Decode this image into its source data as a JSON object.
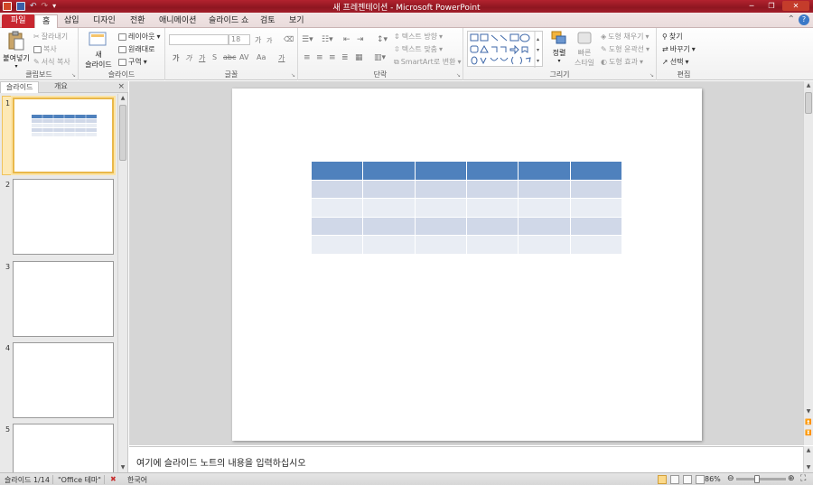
{
  "app": {
    "title": "새 프레젠테이션 - Microsoft PowerPoint"
  },
  "quick_access": {
    "save_icon": "save-icon",
    "undo_icon": "undo-icon",
    "redo_icon": "redo-icon"
  },
  "tabs": [
    {
      "label": "파일"
    },
    {
      "label": "홈"
    },
    {
      "label": "삽입"
    },
    {
      "label": "디자인"
    },
    {
      "label": "전환"
    },
    {
      "label": "애니메이션"
    },
    {
      "label": "슬라이드 쇼"
    },
    {
      "label": "검토"
    },
    {
      "label": "보기"
    }
  ],
  "active_tab": "홈",
  "ribbon": {
    "clipboard": {
      "label": "클립보드",
      "paste": "붙여넣기",
      "cut": "잘라내기",
      "copy": "복사",
      "format_painter": "서식 복사"
    },
    "slides": {
      "label": "슬라이드",
      "new_slide_line1": "새",
      "new_slide_line2": "슬라이드",
      "layout": "레이아웃",
      "reset": "원래대로",
      "section": "구역"
    },
    "font": {
      "label": "글꼴",
      "font_name": "",
      "font_size": "18",
      "grow": "가",
      "shrink": "가",
      "bold": "가",
      "italic": "가",
      "underline": "가",
      "shadow": "S",
      "strike": "abc",
      "spacing": "AV",
      "case": "Aa",
      "color": "가"
    },
    "paragraph": {
      "label": "단락",
      "text_direction": "텍스트 방향",
      "align_text": "텍스트 맞춤",
      "smartart": "SmartArt로 변환"
    },
    "drawing": {
      "label": "그리기",
      "arrange": "정렬",
      "quick_styles_line1": "빠른",
      "quick_styles_line2": "스타일",
      "shape_fill": "도형 채우기",
      "shape_outline": "도형 윤곽선",
      "shape_effects": "도형 효과"
    },
    "editing": {
      "label": "편집",
      "find": "찾기",
      "replace": "바꾸기",
      "select": "선택"
    }
  },
  "panel": {
    "tab_slides": "슬라이드",
    "tab_outline": "개요",
    "close": "×",
    "slide_numbers": [
      "1",
      "2",
      "3",
      "4",
      "5"
    ]
  },
  "notes": {
    "placeholder": "여기에 슬라이드 노트의 내용을 입력하십시오"
  },
  "status": {
    "slide_info": "슬라이드 1/14",
    "theme": "\"Office 테마\"",
    "language": "한국어",
    "zoom": "86%"
  },
  "colors": {
    "table_header": "#4f81bd",
    "table_band_dark": "#d0d8e8",
    "table_band_light": "#e9edf4",
    "file_tab": "#c8262f"
  }
}
